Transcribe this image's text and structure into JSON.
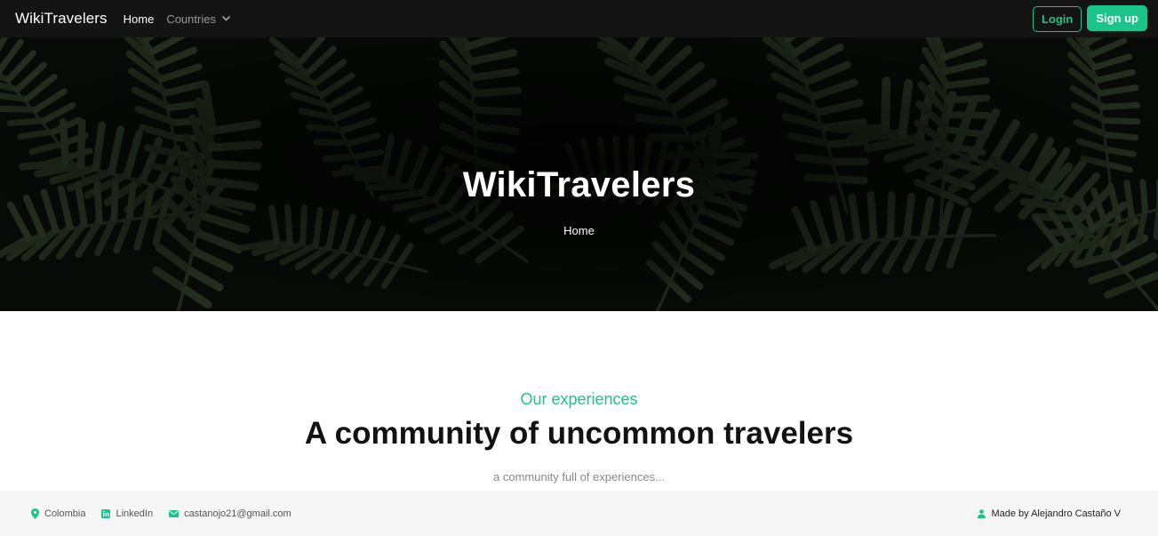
{
  "navbar": {
    "brand": "WikiTravelers",
    "links": {
      "home": "Home",
      "countries": "Countries"
    },
    "login_label": "Login",
    "signup_label": "Sign up"
  },
  "hero": {
    "title": "WikiTravelers",
    "breadcrumb": "Home"
  },
  "section": {
    "subtitle": "Our experiences",
    "title": "A community of uncommon travelers",
    "description": "a community full of experiences..."
  },
  "footer": {
    "location": "Colombia",
    "linkedin": "LinkedIn",
    "email": "castanojo21@gmail.com",
    "made_by": "Made by Alejandro Castaño V"
  },
  "colors": {
    "accent": "#1bc48a",
    "navbar_bg": "#141414",
    "footer_bg": "#f6f6f6"
  },
  "icons": [
    "chevron-down-icon",
    "map-pin-icon",
    "linkedin-icon",
    "envelope-icon",
    "user-icon"
  ]
}
